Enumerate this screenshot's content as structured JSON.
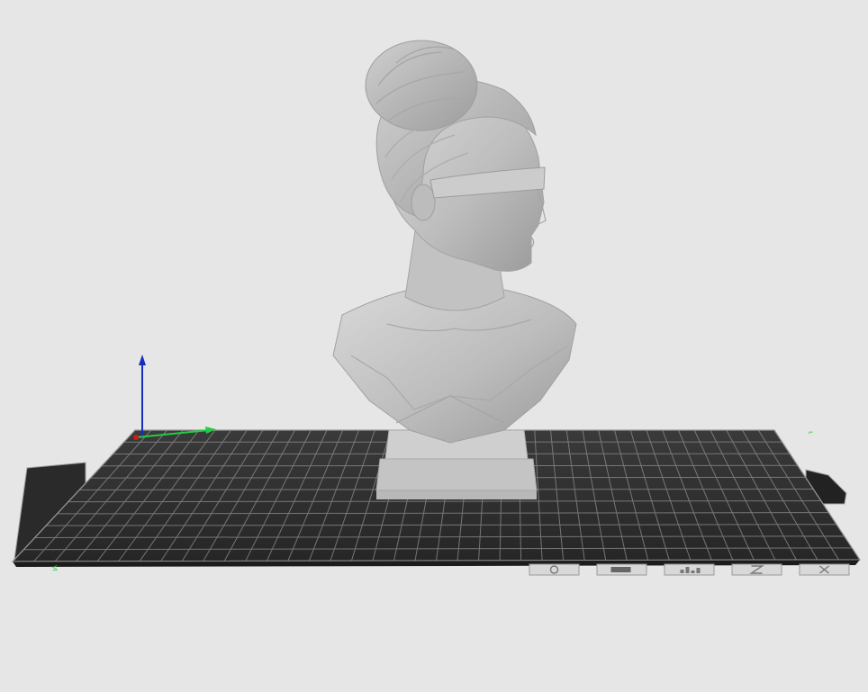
{
  "viewport": {
    "background": "#e6e6e6",
    "bed_color": "#2e2e2e",
    "grid_color": "#8f8f8f",
    "model_color": "#c9c9c9"
  },
  "axes": {
    "x_color": "#22cc44",
    "y_color": "#d11a1a",
    "z_color": "#1a2bbf"
  },
  "bed_front_label": "",
  "bed_buttons": [
    {
      "icon": "gear-icon"
    },
    {
      "icon": "battery-icon"
    },
    {
      "icon": "chart-icon"
    },
    {
      "icon": "z-axis-icon"
    },
    {
      "icon": "close-icon"
    }
  ]
}
